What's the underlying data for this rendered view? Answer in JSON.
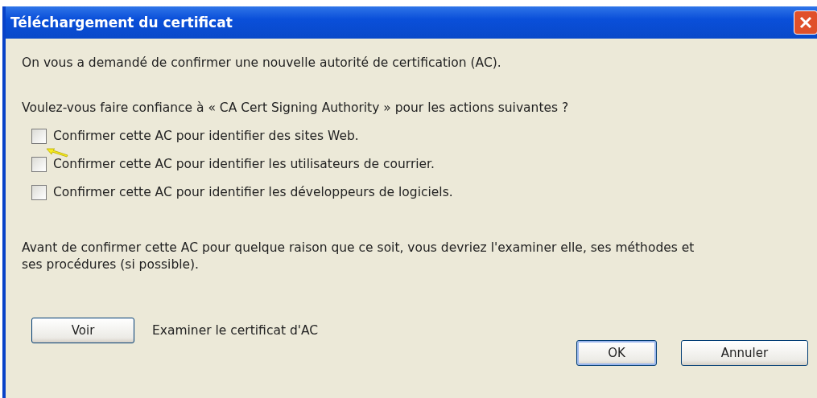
{
  "window": {
    "title": "Téléchargement du certificat"
  },
  "intro": "On vous a demandé de confirmer une nouvelle autorité de certification (AC).",
  "question": "Voulez-vous faire confiance à « CA Cert Signing Authority » pour les actions suivantes ?",
  "options": [
    {
      "label": "Confirmer cette AC pour identifier des sites Web.",
      "checked": false
    },
    {
      "label": "Confirmer cette AC pour identifier les utilisateurs de courrier.",
      "checked": false
    },
    {
      "label": "Confirmer cette AC pour identifier les développeurs de logiciels.",
      "checked": false
    }
  ],
  "warning": "Avant de confirmer cette AC pour quelque raison que ce soit, vous devriez l'examiner elle, ses méthodes et ses procédures (si possible).",
  "view": {
    "button": "Voir",
    "description": "Examiner le certificat d'AC"
  },
  "buttons": [
    {
      "label": "OK",
      "default": true
    },
    {
      "label": "Annuler",
      "default": false
    }
  ]
}
